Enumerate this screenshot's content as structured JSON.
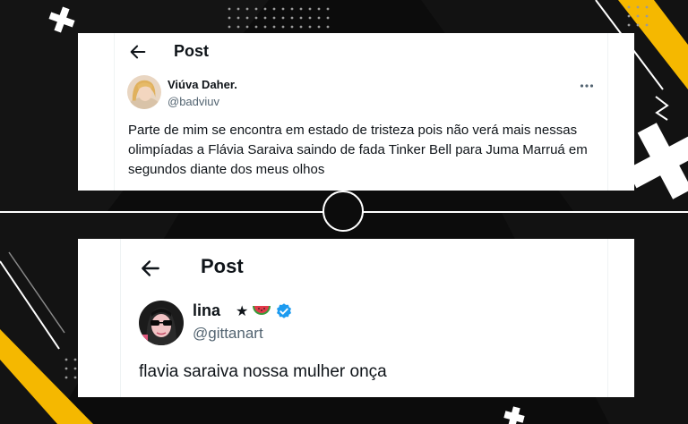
{
  "background": {
    "base_color": "#0c0c0c",
    "accent_color": "#f5b800",
    "line_color": "#ffffff"
  },
  "top_post": {
    "header_title": "Post",
    "author": {
      "display_name": "Viúva Daher.",
      "handle": "@badviuv"
    },
    "text": "Parte de mim se encontra em estado de tristeza pois não verá mais nessas olimpíadas a Flávia Saraiva saindo de fada Tinker Bell para Juma Marruá em segundos diante dos meus olhos",
    "icons": [
      "back-arrow-icon",
      "more-options-icon"
    ]
  },
  "bottom_post": {
    "header_title": "Post",
    "author": {
      "display_name": "lina",
      "name_star": "★",
      "handle": "@gittanart"
    },
    "text": "flavia saraiva nossa mulher onça",
    "icons": [
      "back-arrow-icon",
      "star-icon",
      "watermelon-icon",
      "verified-badge-icon"
    ]
  },
  "colors": {
    "text_primary": "#0f1419",
    "text_secondary": "#536471",
    "verified_blue": "#1d9bf0"
  }
}
